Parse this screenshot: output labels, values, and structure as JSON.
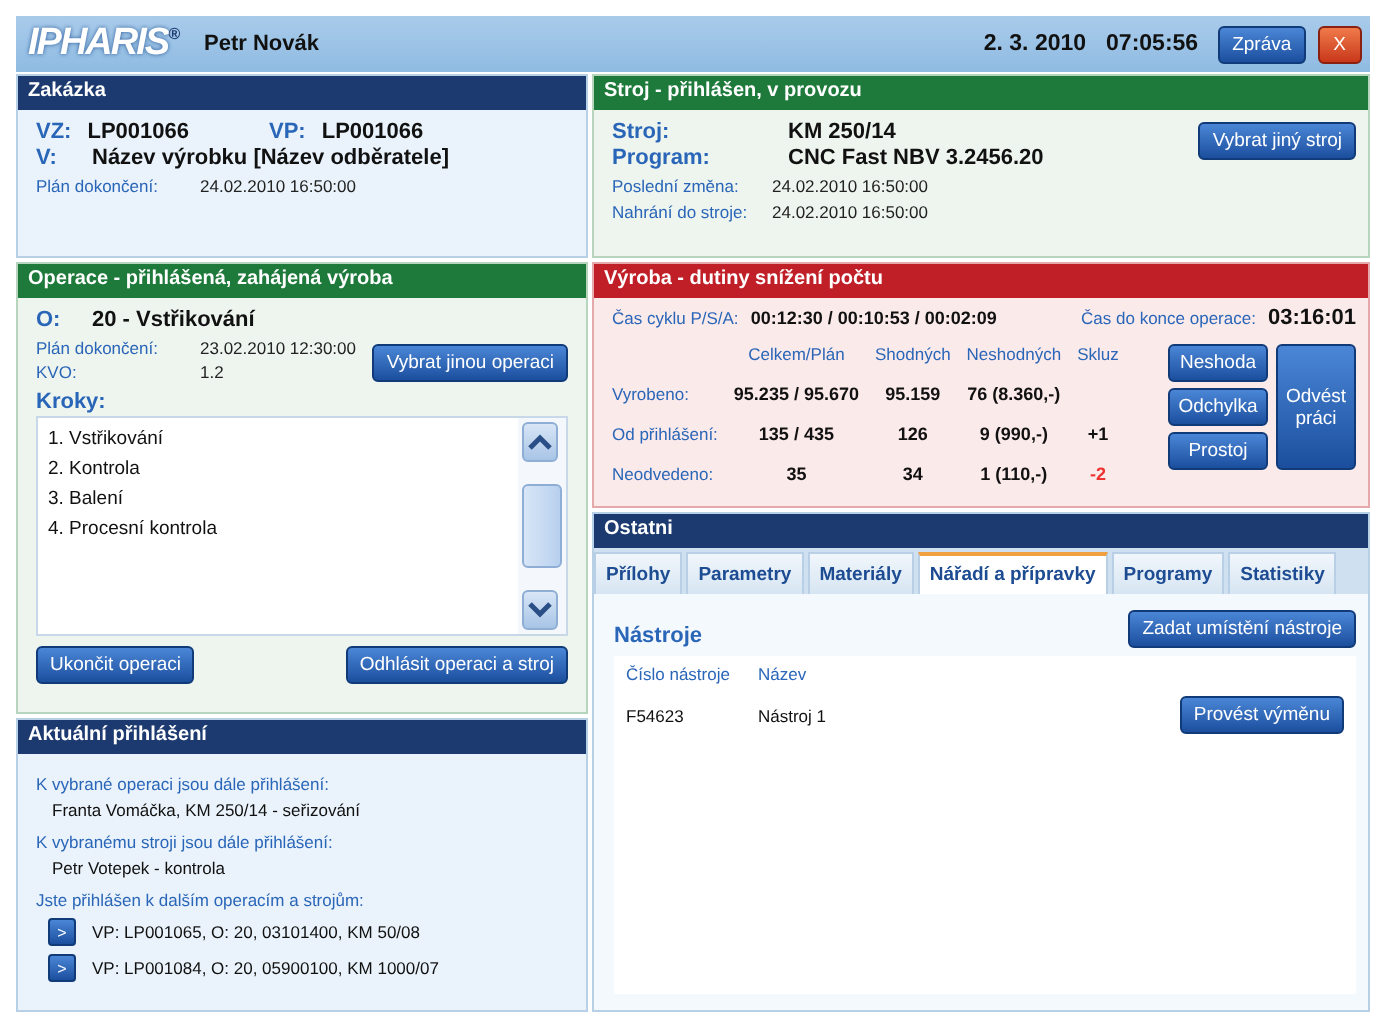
{
  "header": {
    "logo": "IPHARIS",
    "logo_mark": "®",
    "user": "Petr Novák",
    "date": "2. 3. 2010",
    "time": "07:05:56",
    "buttons": [
      {
        "label": "Zpráva",
        "kind": "normal"
      },
      {
        "label": "X",
        "kind": "close"
      }
    ]
  },
  "zakazka": {
    "title": "Zakázka",
    "big": [
      {
        "label": "VZ:",
        "value": "LP001066"
      },
      {
        "label": "VP:",
        "value": "LP001066"
      }
    ],
    "name": {
      "label": "V:",
      "value": "Název výrobku [Název odběratele]"
    },
    "small": [
      {
        "label": "Plán dokončení:",
        "value": "24.02.2010 16:50:00"
      }
    ]
  },
  "stroj": {
    "title": "Stroj - přihlášen, v provozu",
    "big": [
      {
        "label": "Stroj:",
        "value": "KM 250/14"
      },
      {
        "label": "Program:",
        "value": "CNC Fast NBV 3.2456.20"
      }
    ],
    "small": [
      {
        "label": "Poslední změna:",
        "value": "24.02.2010 16:50:00"
      },
      {
        "label": "Nahrání do stroje:",
        "value": "24.02.2010 16:50:00"
      }
    ],
    "button": "Vybrat jiný stroj"
  },
  "operace": {
    "title": "Operace - přihlášená, zahájená výroba",
    "big": {
      "label": "O:",
      "value": "20 - Vstřikování"
    },
    "small": [
      {
        "label": "Plán dokončení:",
        "value": "23.02.2010 12:30:00"
      },
      {
        "label": "KVO:",
        "value": "1.2"
      }
    ],
    "button": "Vybrat jinou operaci",
    "steps_label": "Kroky:",
    "steps": [
      "1. Vstřikování",
      "2. Kontrola",
      "3. Balení",
      "4. Procesní kontrola"
    ],
    "buttons": [
      "Ukončit operaci",
      "Odhlásit operaci a stroj"
    ]
  },
  "vyroba": {
    "title": "Výroba - dutiny snížení počtu",
    "cycle_label": "Čas cyklu P/S/A:",
    "cycle": "00:12:30 / 00:10:53 / 00:02:09",
    "remain_label": "Čas do konce operace:",
    "remain": "03:16:01",
    "columns": [
      "Celkem/Plán",
      "Shodných",
      "Neshodných",
      "Skluz"
    ],
    "rows": [
      {
        "label": "Vyrobeno:",
        "cells": [
          "95.235 / 95.670",
          "95.159",
          "76 (8.360,-)"
        ],
        "skluz": null
      },
      {
        "label": "Od přihlášení:",
        "cells": [
          "135 / 435",
          "126",
          "9 (990,-)"
        ],
        "skluz": {
          "text": "+1",
          "negative": false
        }
      },
      {
        "label": "Neodvedeno:",
        "cells": [
          "35",
          "34",
          "1 (110,-)"
        ],
        "skluz": {
          "text": "-2",
          "negative": true
        }
      }
    ],
    "buttons": [
      "Neshoda",
      "Odchylka",
      "Prostoj"
    ],
    "big_button": "Odvést práci"
  },
  "prihlaseni": {
    "title": "Aktuální přihlášení",
    "groups": [
      {
        "label": "K vybrané operaci jsou dále přihlášení:",
        "items": [
          "Franta Vomáčka, KM 250/14 - seřizování"
        ]
      },
      {
        "label": "K vybranému stroji jsou dále přihlášení:",
        "items": [
          "Petr Votepek - kontrola"
        ]
      }
    ],
    "links_label": "Jste přihlášen k dalším operacím a strojům:",
    "links": [
      {
        "button": ">",
        "text": "VP: LP001065, O: 20, 03101400, KM 50/08"
      },
      {
        "button": ">",
        "text": "VP: LP001084, O: 20, 05900100, KM 1000/07"
      }
    ]
  },
  "ostatni": {
    "title": "Ostatni",
    "tabs": [
      {
        "label": "Přílohy",
        "selected": false
      },
      {
        "label": "Parametry",
        "selected": false
      },
      {
        "label": "Materiály",
        "selected": false
      },
      {
        "label": "Nářadí a přípravky",
        "selected": true
      },
      {
        "label": "Programy",
        "selected": false
      },
      {
        "label": "Statistiky",
        "selected": false
      }
    ],
    "section": "Nástroje",
    "button": "Zadat umístění nástroje",
    "columns": [
      "Číslo nástroje",
      "Název"
    ],
    "rows": [
      {
        "cells": [
          "F54623",
          "Nástroj 1"
        ],
        "button": "Provést výměnu"
      }
    ]
  }
}
